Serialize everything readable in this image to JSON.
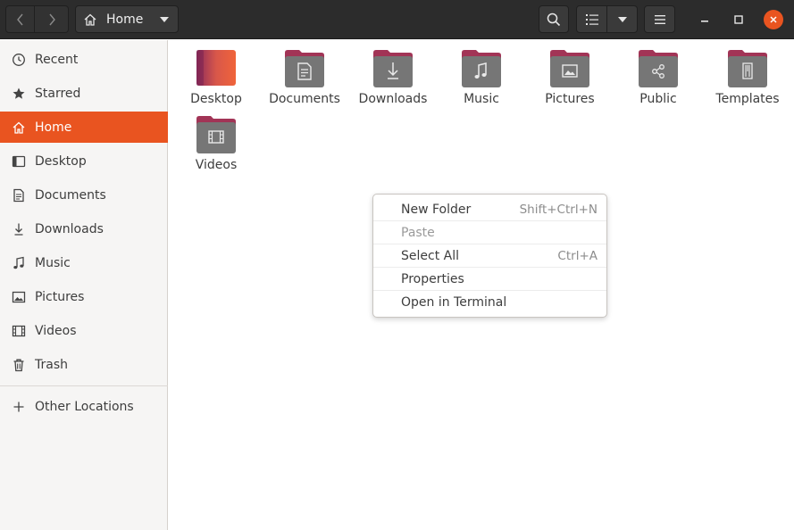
{
  "window": {
    "path_label": "Home"
  },
  "sidebar": {
    "items": [
      {
        "label": "Recent",
        "icon": "clock-icon",
        "active": false
      },
      {
        "label": "Starred",
        "icon": "star-icon",
        "active": false
      },
      {
        "label": "Home",
        "icon": "home-icon",
        "active": true
      },
      {
        "label": "Desktop",
        "icon": "desktop-icon",
        "active": false
      },
      {
        "label": "Documents",
        "icon": "document-icon",
        "active": false
      },
      {
        "label": "Downloads",
        "icon": "download-icon",
        "active": false
      },
      {
        "label": "Music",
        "icon": "music-icon",
        "active": false
      },
      {
        "label": "Pictures",
        "icon": "picture-icon",
        "active": false
      },
      {
        "label": "Videos",
        "icon": "video-icon",
        "active": false
      },
      {
        "label": "Trash",
        "icon": "trash-icon",
        "active": false
      }
    ],
    "other_locations": {
      "label": "Other Locations",
      "icon": "plus-icon"
    }
  },
  "files": [
    {
      "name": "Desktop",
      "icon": "desktop-folder-icon"
    },
    {
      "name": "Documents",
      "icon": "documents-folder-icon"
    },
    {
      "name": "Downloads",
      "icon": "downloads-folder-icon"
    },
    {
      "name": "Music",
      "icon": "music-folder-icon"
    },
    {
      "name": "Pictures",
      "icon": "pictures-folder-icon"
    },
    {
      "name": "Public",
      "icon": "public-folder-icon"
    },
    {
      "name": "Templates",
      "icon": "templates-folder-icon"
    },
    {
      "name": "Videos",
      "icon": "videos-folder-icon"
    }
  ],
  "context_menu": {
    "items": [
      {
        "label": "New Folder",
        "shortcut": "Shift+Ctrl+N",
        "disabled": false
      },
      {
        "label": "Paste",
        "shortcut": "",
        "disabled": true
      },
      {
        "label": "Select All",
        "shortcut": "Ctrl+A",
        "disabled": false
      },
      {
        "label": "Properties",
        "shortcut": "",
        "disabled": false
      },
      {
        "label": "Open in Terminal",
        "shortcut": "",
        "disabled": false
      }
    ]
  },
  "colors": {
    "accent": "#e95420",
    "folder_top": "#a23456",
    "folder_body": "#747474",
    "header": "#2c2c2c"
  }
}
